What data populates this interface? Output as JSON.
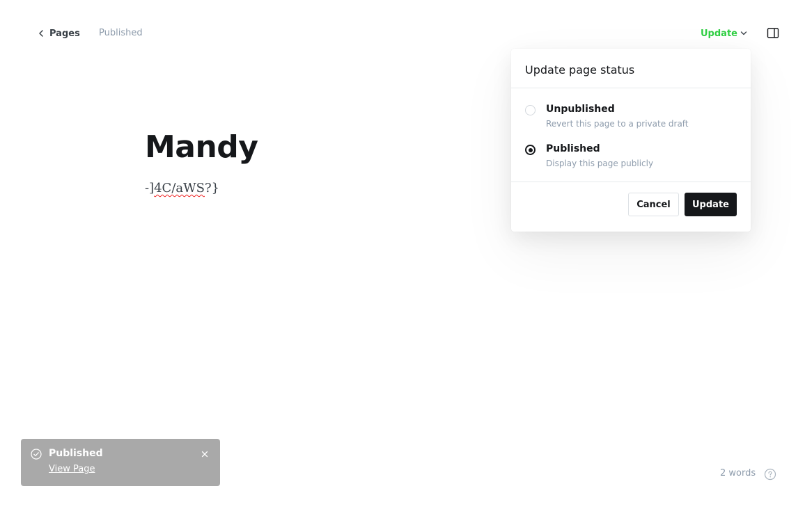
{
  "header": {
    "back_label": "Pages",
    "post_status": "Published",
    "update_label": "Update"
  },
  "editor": {
    "title": "Mandy",
    "body_prefix": "-]",
    "body_word1": "4C/aWS",
    "body_suffix": "?}"
  },
  "popover": {
    "title": "Update page status",
    "options": [
      {
        "label": "Unpublished",
        "description": "Revert this page to a private draft",
        "checked": false
      },
      {
        "label": "Published",
        "description": "Display this page publicly",
        "checked": true
      }
    ],
    "cancel_label": "Cancel",
    "confirm_label": "Update"
  },
  "toast": {
    "title": "Published",
    "link_label": "View Page"
  },
  "footer": {
    "word_count": "2 words"
  },
  "colors": {
    "accent_green": "#30cf43",
    "primary_dark": "#15171a",
    "muted_text": "#8e9cac",
    "toast_bg": "#a9a9a9"
  },
  "icons": {
    "back": "chevron-left-icon",
    "update_dropdown": "chevron-down-icon",
    "settings": "sidebar-toggle-icon",
    "toast_status": "check-circle-icon",
    "toast_close": "close-icon",
    "help": "question-circle-icon"
  }
}
